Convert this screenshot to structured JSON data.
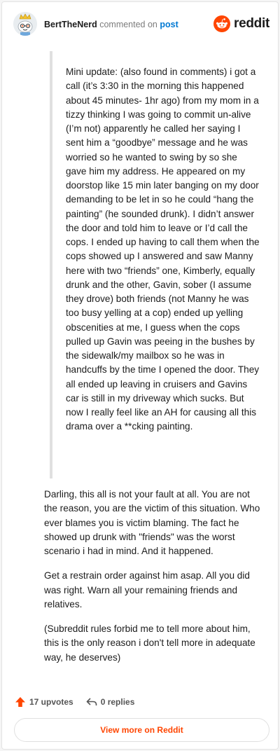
{
  "header": {
    "author": "BertTheNerd",
    "action": "commented on",
    "target": "post",
    "brand": "reddit"
  },
  "quote": {
    "text": "Mini update: (also found in comments) i got a call (it’s 3:30 in the morning this happened about 45 minutes- 1hr ago) from my mom in a tizzy thinking I was going to commit un-alive (I’m not) apparently he called her saying I sent him a “goodbye” message and he was worried so he wanted to swing by so she gave him my address. He appeared on my doorstop like 15 min later banging on my door demanding to be let in so he could “hang the painting” (he sounded drunk). I didn’t answer the door and told him to leave or I’d call the cops. I ended up having to call them when the cops showed up I answered and saw Manny here with two “friends” one, Kimberly, equally drunk and the other, Gavin, sober (I assume they drove) both friends (not Manny he was too busy yelling at a cop) ended up yelling obscenities at me, I guess when the cops pulled up Gavin was peeing in the bushes by the sidewalk/my mailbox so he was in handcuffs by the time I opened the door. They all ended up leaving in cruisers and Gavins car is still in my driveway which sucks. But now I really feel like an AH for causing all this drama over a **cking painting."
  },
  "comment": {
    "paragraphs": [
      "Darling, this all is not your fault at all. You are not the reason, you are the victim of this situation. Who ever blames you is victim blaming. The fact he showed up drunk with \"friends\" was the worst scenario i had in mind. And it happened.",
      "Get a restrain order against him asap. All you did was right. Warn all your remaining friends and relatives.",
      "(Subreddit rules forbid me to tell more about him, this is the only reason i don't tell more in adequate way, he deserves)"
    ]
  },
  "footer": {
    "upvotes": "17 upvotes",
    "replies": "0 replies",
    "view_more": "View more on Reddit"
  },
  "colors": {
    "accent": "#ff4500",
    "link": "#0079d3",
    "quote_bar": "#e0e0e0"
  }
}
